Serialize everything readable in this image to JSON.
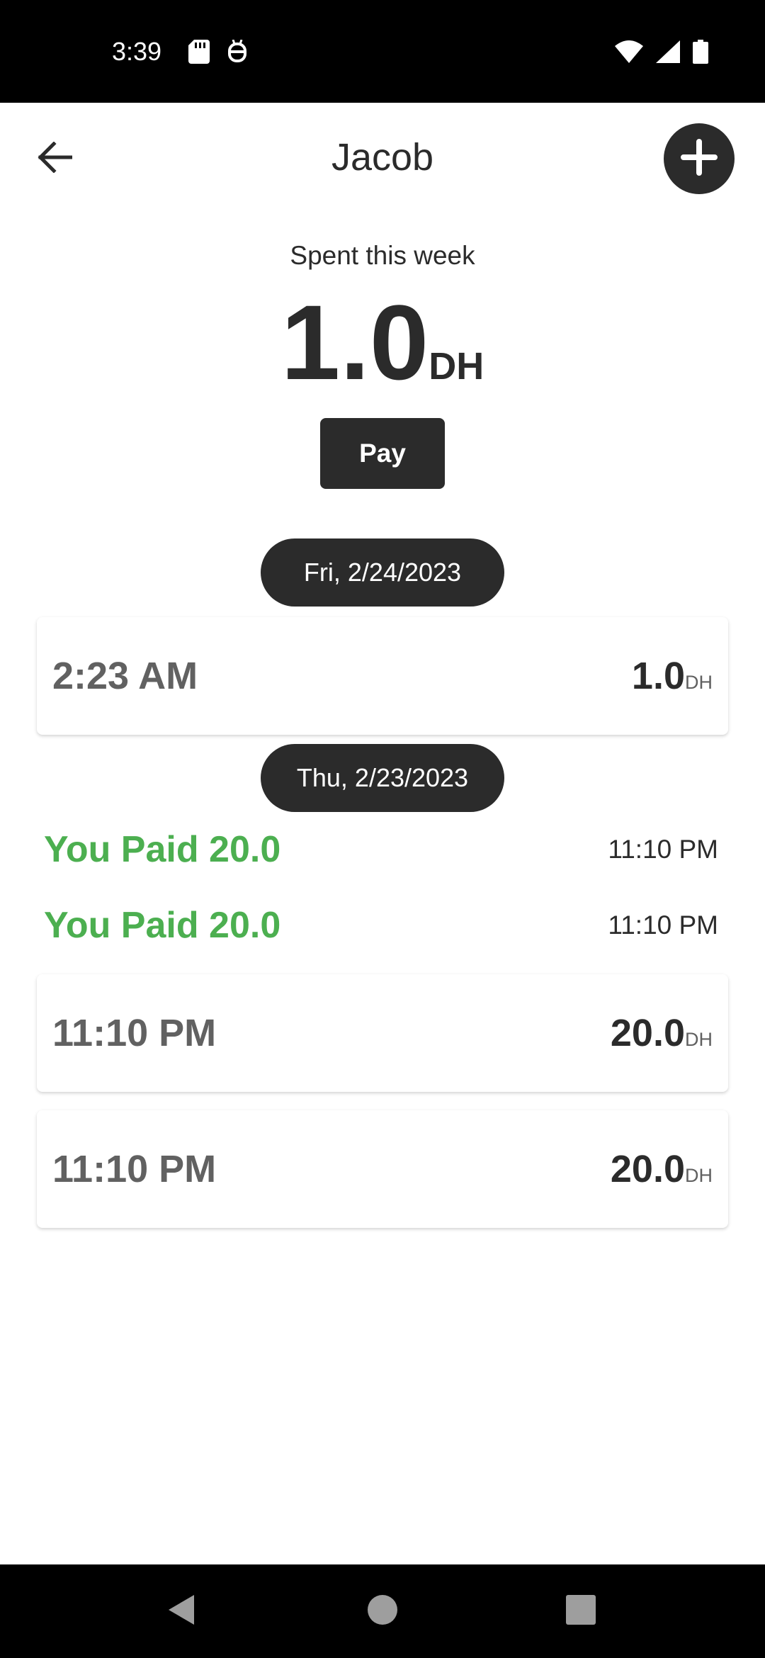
{
  "status_bar": {
    "time": "3:39",
    "icons": [
      "sd-card-icon",
      "android-debug-icon",
      "wifi-icon",
      "signal-icon",
      "battery-icon"
    ]
  },
  "app_bar": {
    "title": "Jacob",
    "back_icon": "arrow-left-icon",
    "add_icon": "plus-icon"
  },
  "summary": {
    "label": "Spent this week",
    "amount": "1.0",
    "unit": "DH",
    "pay_label": "Pay"
  },
  "groups": [
    {
      "date": "Fri, 2/24/2023",
      "payments": [],
      "entries": [
        {
          "time": "2:23 AM",
          "amount": "1.0",
          "unit": "DH"
        }
      ]
    },
    {
      "date": "Thu, 2/23/2023",
      "payments": [
        {
          "text": "You Paid 20.0",
          "time": "11:10 PM"
        },
        {
          "text": "You Paid 20.0",
          "time": "11:10 PM"
        }
      ],
      "entries": [
        {
          "time": "11:10 PM",
          "amount": "20.0",
          "unit": "DH"
        },
        {
          "time": "11:10 PM",
          "amount": "20.0",
          "unit": "DH"
        }
      ]
    }
  ],
  "colors": {
    "primary": "#2b2b2b",
    "paid_green": "#4caf50",
    "muted_text": "#616161"
  },
  "nav_bar": {
    "icons": [
      "back-triangle-icon",
      "home-circle-icon",
      "recents-square-icon"
    ]
  }
}
